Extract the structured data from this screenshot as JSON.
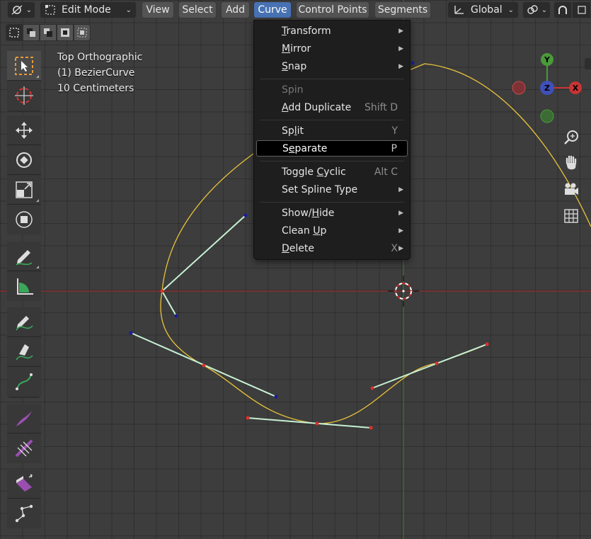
{
  "header": {
    "mode": {
      "label": "Edit Mode"
    },
    "menus": [
      "View",
      "Select",
      "Add",
      "Curve",
      "Control Points",
      "Segments"
    ],
    "active_menu": "Curve",
    "orientation": {
      "label": "Global"
    }
  },
  "overlay": {
    "view_name": "Top Orthographic",
    "object_name": "(1) BezierCurve",
    "scale": "10 Centimeters"
  },
  "gizmo": {
    "x": "X",
    "y": "Y",
    "z": "Z"
  },
  "curve_menu": {
    "items": [
      {
        "label": "Transform",
        "underline": "T",
        "shortcut": "",
        "submenu": true
      },
      {
        "label": "Mirror",
        "underline": "M",
        "shortcut": "",
        "submenu": true
      },
      {
        "label": "Snap",
        "underline": "S",
        "shortcut": "",
        "submenu": true
      },
      {
        "label": "Spin",
        "underline": "",
        "shortcut": "",
        "submenu": false,
        "disabled": true
      },
      {
        "label": "Add Duplicate",
        "underline": "A",
        "shortcut": "Shift D",
        "submenu": false
      },
      {
        "label": "Split",
        "underline": "l",
        "shortcut": "Y",
        "submenu": false
      },
      {
        "label": "Separate",
        "underline": "e",
        "shortcut": "P",
        "submenu": false,
        "highlighted": true
      },
      {
        "label": "Toggle Cyclic",
        "underline": "C",
        "shortcut": "Alt C",
        "submenu": false
      },
      {
        "label": "Set Spline Type",
        "underline": "",
        "shortcut": "",
        "submenu": true
      },
      {
        "label": "Show/Hide",
        "underline": "H",
        "shortcut": "",
        "submenu": true
      },
      {
        "label": "Clean Up",
        "underline": "U",
        "shortcut": "",
        "submenu": true
      },
      {
        "label": "Delete",
        "underline": "D",
        "shortcut": "X",
        "submenu": true
      }
    ]
  },
  "tools": [
    "select-box",
    "cursor",
    "move",
    "rotate",
    "scale",
    "transform",
    "annotate",
    "measure",
    "draw",
    "pen",
    "curve-pen",
    "extrude",
    "radius",
    "tilt",
    "randomize",
    "extrude-region",
    "vertex-path"
  ],
  "colors": {
    "grid_bg": "#3d3d3d",
    "x_axis": "#8b2f2f",
    "y_axis": "#3f6b2a",
    "curve": "#e8c33a",
    "handle_line": "#c6f0d4",
    "selected_point": "#e0302a",
    "unselected_point": "#1c1c9e",
    "menu_bg": "#1e1e1e",
    "accent": "#4772b3"
  }
}
